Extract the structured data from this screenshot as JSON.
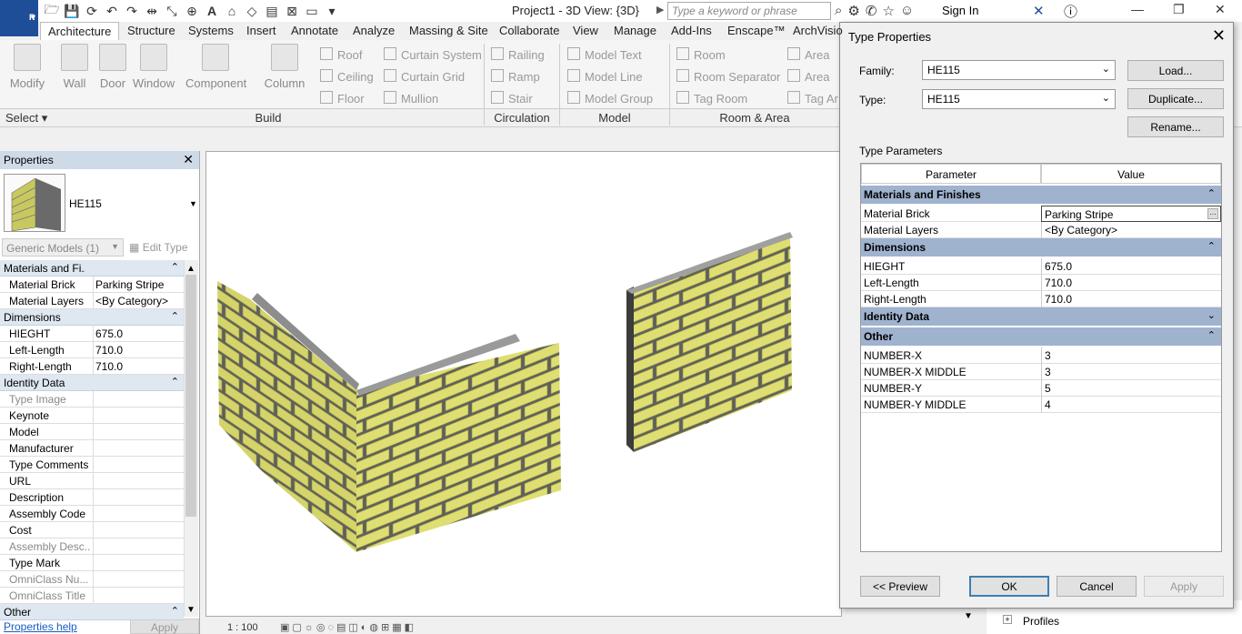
{
  "app": {
    "title": "Project1 - 3D View: {3D}",
    "logo": "R",
    "search_placeholder": "Type a keyword or phrase",
    "sign_in": "Sign In"
  },
  "tabs": [
    "Architecture",
    "Structure",
    "Systems",
    "Insert",
    "Annotate",
    "Analyze",
    "Massing & Site",
    "Collaborate",
    "View",
    "Manage",
    "Add-Ins",
    "Enscape™",
    "ArchVisio"
  ],
  "ribbon": {
    "select_label": "Select",
    "modify": "Modify",
    "build_tools": [
      "Wall",
      "Door",
      "Window",
      "Component",
      "Column"
    ],
    "build_small": [
      "Roof",
      "Ceiling",
      "Floor",
      "Curtain System",
      "Curtain Grid",
      "Mullion"
    ],
    "circulation": [
      "Railing",
      "Ramp",
      "Stair"
    ],
    "model": [
      "Model Text",
      "Model Line",
      "Model Group"
    ],
    "room_area": [
      "Room",
      "Room Separator",
      "Tag Room",
      "Area",
      "Area",
      "Tag Ar"
    ],
    "panels": [
      "Build",
      "Circulation",
      "Model",
      "Room & Area"
    ]
  },
  "properties": {
    "title": "Properties",
    "type_name": "HE115",
    "category": "Generic Models (1)",
    "edit_type": "Edit Type",
    "rows": [
      {
        "k": "Materials and Fi...",
        "grp": true
      },
      {
        "k": "Material Brick",
        "v": "Parking Stripe"
      },
      {
        "k": "Material Layers",
        "v": "<By Category>"
      },
      {
        "k": "Dimensions",
        "grp": true
      },
      {
        "k": "HIEGHT",
        "v": "675.0"
      },
      {
        "k": "Left-Length",
        "v": "710.0"
      },
      {
        "k": "Right-Length",
        "v": "710.0"
      },
      {
        "k": "Identity Data",
        "grp": true
      },
      {
        "k": "Type Image",
        "v": "",
        "gray": true
      },
      {
        "k": "Keynote",
        "v": ""
      },
      {
        "k": "Model",
        "v": ""
      },
      {
        "k": "Manufacturer",
        "v": ""
      },
      {
        "k": "Type Comments",
        "v": ""
      },
      {
        "k": "URL",
        "v": ""
      },
      {
        "k": "Description",
        "v": ""
      },
      {
        "k": "Assembly Code",
        "v": ""
      },
      {
        "k": "Cost",
        "v": ""
      },
      {
        "k": "Assembly Desc...",
        "v": "",
        "gray": true
      },
      {
        "k": "Type Mark",
        "v": ""
      },
      {
        "k": "OmniClass Nu...",
        "v": "",
        "gray": true
      },
      {
        "k": "OmniClass Title",
        "v": "",
        "gray": true
      },
      {
        "k": "Other",
        "grp": true
      }
    ],
    "help": "Properties help",
    "apply": "Apply"
  },
  "view": {
    "scale": "1 : 100"
  },
  "browser": {
    "item": "Profiles"
  },
  "dialog": {
    "title": "Type Properties",
    "family_label": "Family:",
    "family_value": "HE115",
    "type_label": "Type:",
    "type_value": "HE115",
    "load": "Load...",
    "duplicate": "Duplicate...",
    "rename": "Rename...",
    "type_parameters": "Type Parameters",
    "col_param": "Parameter",
    "col_value": "Value",
    "groups": [
      {
        "name": "Materials and Finishes",
        "collapsed": false,
        "rows": [
          {
            "k": "Material Brick",
            "v": "Parking Stripe",
            "edit": true
          },
          {
            "k": "Material Layers",
            "v": "<By Category>"
          }
        ]
      },
      {
        "name": "Dimensions",
        "collapsed": false,
        "rows": [
          {
            "k": "HIEGHT",
            "v": "675.0"
          },
          {
            "k": "Left-Length",
            "v": "710.0"
          },
          {
            "k": "Right-Length",
            "v": "710.0"
          }
        ]
      },
      {
        "name": "Identity Data",
        "collapsed": true,
        "rows": []
      },
      {
        "name": "Other",
        "collapsed": false,
        "rows": [
          {
            "k": "NUMBER-X",
            "v": "3"
          },
          {
            "k": "NUMBER-X MIDDLE",
            "v": "3"
          },
          {
            "k": "NUMBER-Y",
            "v": "5"
          },
          {
            "k": "NUMBER-Y MIDDLE",
            "v": "4"
          }
        ]
      }
    ],
    "preview": "<< Preview",
    "ok": "OK",
    "cancel": "Cancel",
    "apply": "Apply"
  },
  "colors": {
    "brick": "#d8d86a",
    "mortar": "#6e6e6e",
    "header": "#9fb3cf"
  }
}
